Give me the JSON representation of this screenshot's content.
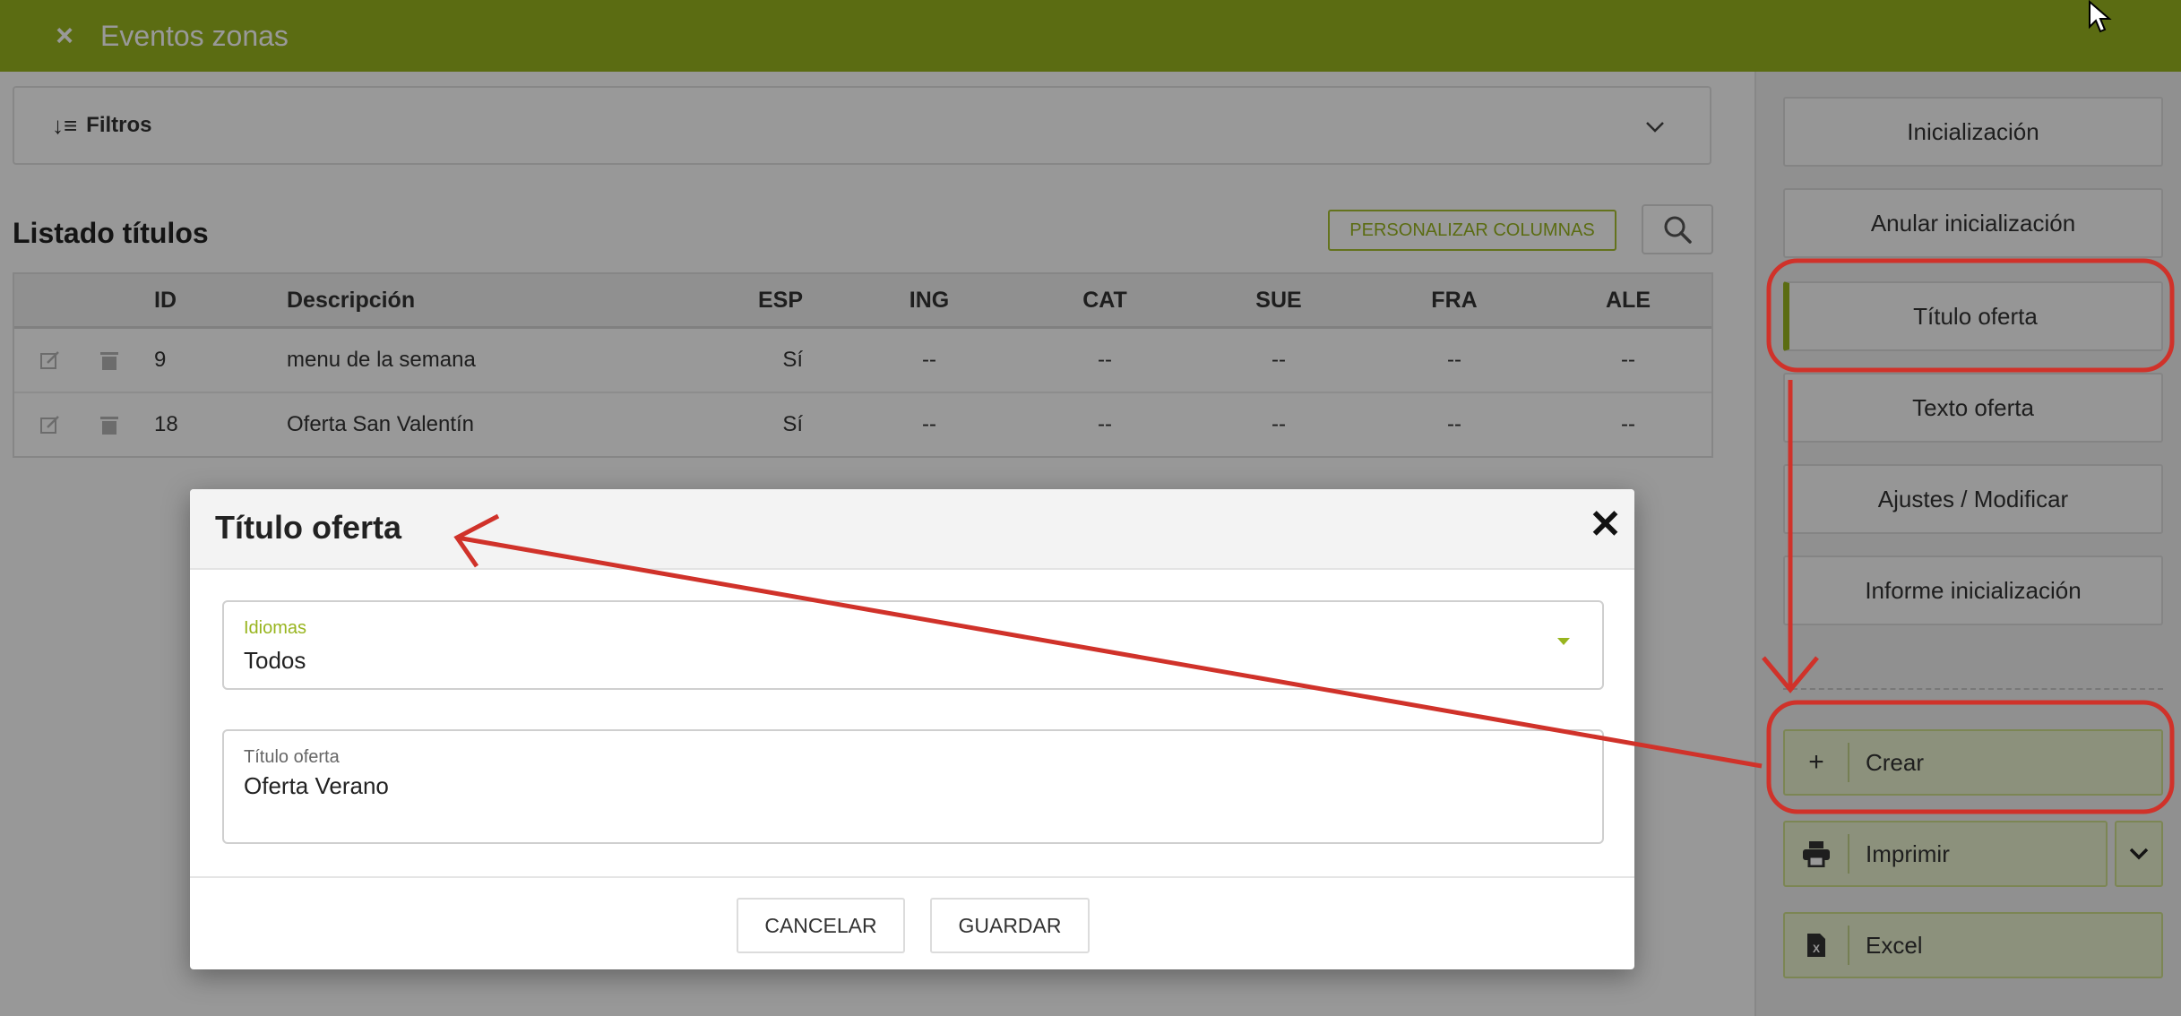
{
  "header": {
    "close_icon": "×",
    "title": "Eventos zonas"
  },
  "filters": {
    "icon": "↓≡",
    "label": "Filtros",
    "chevron": "⌄"
  },
  "list": {
    "title": "Listado títulos",
    "customize_button": "PERSONALIZAR COLUMNAS",
    "columns": [
      "ID",
      "Descripción",
      "ESP",
      "ING",
      "CAT",
      "SUE",
      "FRA",
      "ALE"
    ],
    "rows": [
      {
        "id": "9",
        "desc": "menu de la semana",
        "esp": "Sí",
        "ing": "--",
        "cat": "--",
        "sue": "--",
        "fra": "--",
        "ale": "--"
      },
      {
        "id": "18",
        "desc": "Oferta San Valentín",
        "esp": "Sí",
        "ing": "--",
        "cat": "--",
        "sue": "--",
        "fra": "--",
        "ale": "--"
      }
    ]
  },
  "sidebar": {
    "items": [
      {
        "label": "Inicialización"
      },
      {
        "label": "Anular inicialización"
      },
      {
        "label": "Título oferta",
        "active": true
      },
      {
        "label": "Texto oferta"
      },
      {
        "label": "Ajustes / Modificar"
      },
      {
        "label": "Informe inicialización"
      }
    ],
    "actions": {
      "create": {
        "icon": "+",
        "label": "Crear"
      },
      "print": {
        "label": "Imprimir"
      },
      "excel": {
        "label": "Excel"
      }
    }
  },
  "modal": {
    "title": "Título oferta",
    "close_icon": "✕",
    "language_field": {
      "label": "Idiomas",
      "value": "Todos"
    },
    "title_field": {
      "label": "Título oferta",
      "value": "Oferta Verano"
    },
    "cancel": "CANCELAR",
    "save": "GUARDAR"
  },
  "colors": {
    "accent": "#98b51f",
    "annotation": "#d0322a"
  }
}
